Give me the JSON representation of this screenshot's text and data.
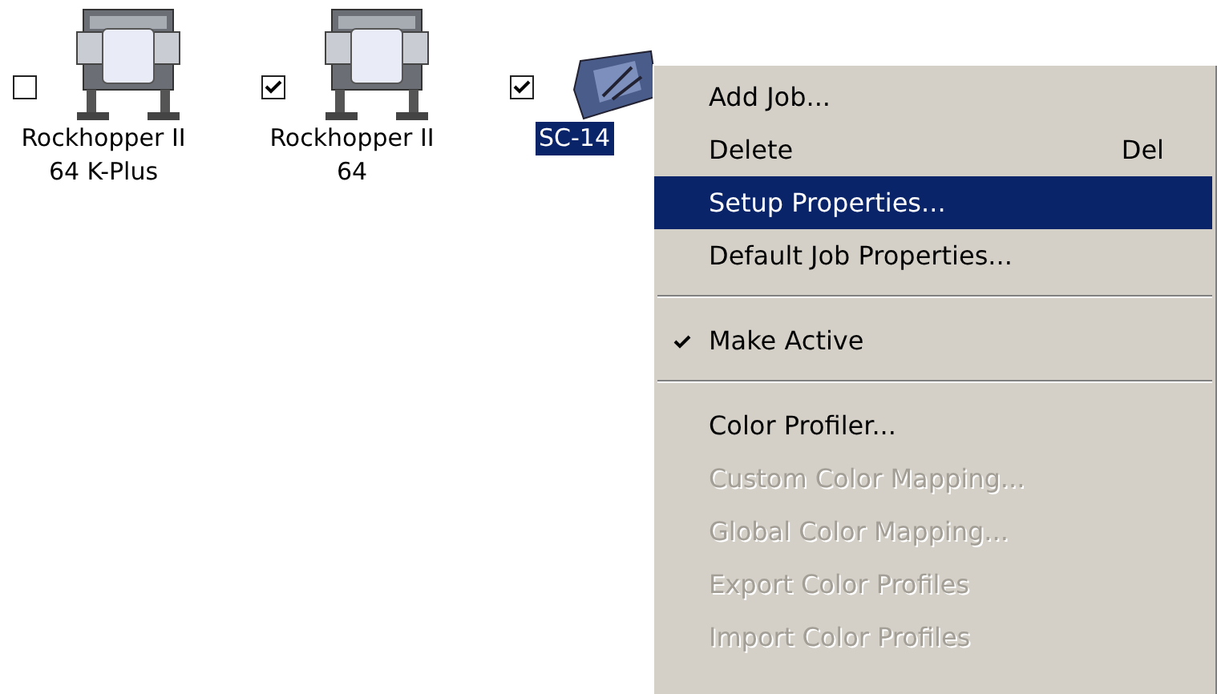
{
  "devices": [
    {
      "kind": "printer",
      "label": "Rockhopper II\n64 K-Plus",
      "checked": false,
      "selected": false
    },
    {
      "kind": "printer",
      "label": "Rockhopper II\n64",
      "checked": true,
      "selected": false
    },
    {
      "kind": "cutter",
      "label": "SC-14",
      "checked": true,
      "selected": true
    }
  ],
  "context_menu": {
    "items": [
      {
        "kind": "item",
        "label": "Add Job...",
        "selected": false,
        "disabled": false,
        "checked": false
      },
      {
        "kind": "item",
        "label": "Delete",
        "shortcut": "Del",
        "selected": false,
        "disabled": false,
        "checked": false
      },
      {
        "kind": "item",
        "label": "Setup Properties...",
        "selected": true,
        "disabled": false,
        "checked": false
      },
      {
        "kind": "item",
        "label": "Default Job Properties...",
        "selected": false,
        "disabled": false,
        "checked": false
      },
      {
        "kind": "separator"
      },
      {
        "kind": "item",
        "label": "Make Active",
        "selected": false,
        "disabled": false,
        "checked": true
      },
      {
        "kind": "separator"
      },
      {
        "kind": "item",
        "label": "Color Profiler...",
        "selected": false,
        "disabled": false,
        "checked": false
      },
      {
        "kind": "item",
        "label": "Custom Color Mapping...",
        "selected": false,
        "disabled": true,
        "checked": false
      },
      {
        "kind": "item",
        "label": "Global Color Mapping...",
        "selected": false,
        "disabled": true,
        "checked": false
      },
      {
        "kind": "item",
        "label": "Export Color Profiles",
        "selected": false,
        "disabled": true,
        "checked": false
      },
      {
        "kind": "item",
        "label": "Import Color Profiles",
        "selected": false,
        "disabled": true,
        "checked": false
      }
    ]
  }
}
